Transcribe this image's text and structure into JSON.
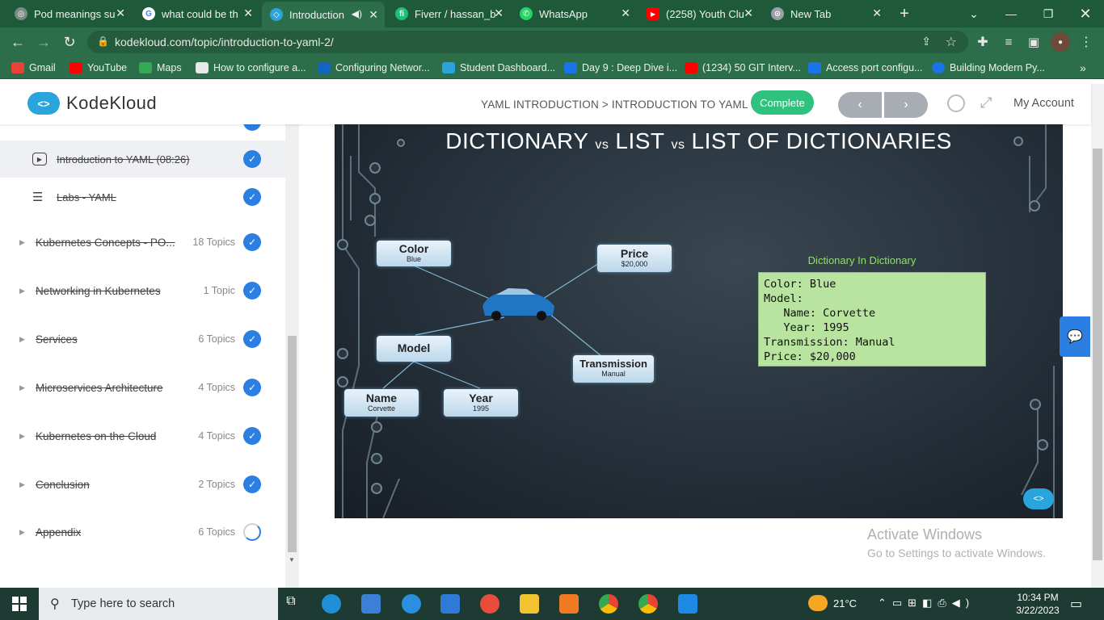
{
  "tabs": [
    {
      "title": "Pod meanings su",
      "color": "#7a8a86",
      "glyph": "◎"
    },
    {
      "title": "what could be th",
      "color": "#ffffff",
      "glyph": "G"
    },
    {
      "title": "Introduction",
      "color": "#2aa4dc",
      "glyph": "◇"
    },
    {
      "title": "Fiverr / hassan_b",
      "color": "#1dbf73",
      "glyph": "fi"
    },
    {
      "title": "WhatsApp",
      "color": "#25d366",
      "glyph": "✆"
    },
    {
      "title": "(2258) Youth Clu",
      "color": "#ff0000",
      "glyph": "▶"
    },
    {
      "title": "New Tab",
      "color": "#9aa0a6",
      "glyph": "⊙"
    }
  ],
  "address": {
    "url": "kodekloud.com/topic/introduction-to-yaml-2/"
  },
  "bookmarks": [
    {
      "label": "Gmail",
      "color": "#ea4335"
    },
    {
      "label": "YouTube",
      "color": "#ff0000"
    },
    {
      "label": "Maps",
      "color": "#34a853"
    },
    {
      "label": "How to configure a...",
      "color": "#e9e9e9"
    },
    {
      "label": "Configuring Networ...",
      "color": "#1565c0"
    },
    {
      "label": "Student Dashboard...",
      "color": "#2aa4dc"
    },
    {
      "label": "Day 9 : Deep Dive i...",
      "color": "#1a73e8"
    },
    {
      "label": "(1234) 50 GIT Interv...",
      "color": "#ff0000"
    },
    {
      "label": "Access port configu...",
      "color": "#1a73e8"
    },
    {
      "label": "Building Modern Py...",
      "color": "#1a73e8"
    }
  ],
  "header": {
    "logo_text": "KodeKloud",
    "breadcrumb": "YAML INTRODUCTION > INTRODUCTION TO YAML",
    "complete_label": "Complete",
    "prev_label": "‹",
    "next_label": "›",
    "account_label": "My Account"
  },
  "sidebar": {
    "lessons": [
      {
        "label": "Introduction to YAML (08:26)",
        "icon": "play-icon",
        "status": "done"
      },
      {
        "label": "Labs - YAML",
        "icon": "lab-icon",
        "status": "done"
      }
    ],
    "sections": [
      {
        "label": "Kubernetes Concepts - PO...",
        "count": "18 Topics",
        "status": "done"
      },
      {
        "label": "Networking in Kubernetes",
        "count": "1 Topic",
        "status": "done"
      },
      {
        "label": "Services",
        "count": "6 Topics",
        "status": "done"
      },
      {
        "label": "Microservices Architecture",
        "count": "4 Topics",
        "status": "done"
      },
      {
        "label": "Kubernetes on the Cloud",
        "count": "4 Topics",
        "status": "done"
      },
      {
        "label": "Conclusion",
        "count": "2 Topics",
        "status": "done"
      },
      {
        "label": "Appendix",
        "count": "6 Topics",
        "status": "in-progress"
      }
    ]
  },
  "slide": {
    "title_a": "DICTIONARY",
    "vs1": "vs",
    "title_b": "LIST",
    "vs2": "vs",
    "title_c": "LIST OF DICTIONARIES",
    "nodes": [
      {
        "key": "Color",
        "value": "Blue"
      },
      {
        "key": "Price",
        "value": "$20,000"
      },
      {
        "key": "Model",
        "value": ""
      },
      {
        "key": "Transmission",
        "value": "Manual"
      },
      {
        "key": "Name",
        "value": "Corvette"
      },
      {
        "key": "Year",
        "value": "1995"
      }
    ],
    "dict_title": "Dictionary In Dictionary",
    "dict_lines": [
      "Color: Blue",
      "Model:",
      "   Name: Corvette",
      "   Year: 1995",
      "Transmission: Manual",
      "Price: $20,000"
    ]
  },
  "watermark": {
    "line1": "Activate Windows",
    "line2": "Go to Settings to activate Windows."
  },
  "taskbar": {
    "search_placeholder": "Type here to search",
    "temperature": "21°C",
    "time": "10:34 PM",
    "date": "3/22/2023"
  }
}
